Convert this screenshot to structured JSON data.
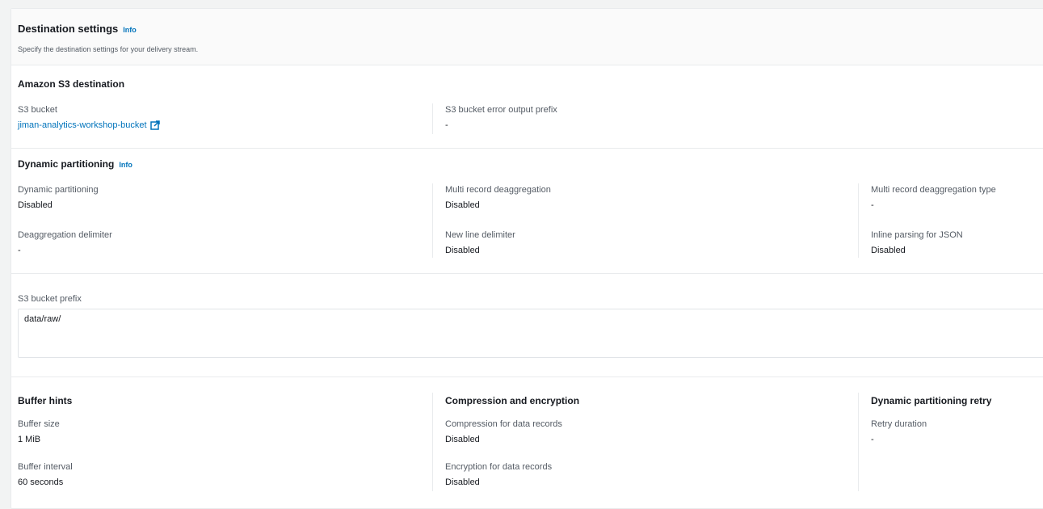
{
  "header": {
    "title": "Destination settings",
    "info": "Info",
    "description": "Specify the destination settings for your delivery stream."
  },
  "s3_destination": {
    "title": "Amazon S3 destination",
    "bucket_label": "S3 bucket",
    "bucket_value": "jiman-analytics-workshop-bucket",
    "error_prefix_label": "S3 bucket error output prefix",
    "error_prefix_value": "-"
  },
  "dynamic_partitioning": {
    "title": "Dynamic partitioning",
    "info": "Info",
    "fields": {
      "dynamic_partitioning": {
        "label": "Dynamic partitioning",
        "value": "Disabled"
      },
      "multi_record_deaggregation": {
        "label": "Multi record deaggregation",
        "value": "Disabled"
      },
      "multi_record_deaggregation_type": {
        "label": "Multi record deaggregation type",
        "value": "-"
      },
      "deaggregation_delimiter": {
        "label": "Deaggregation delimiter",
        "value": "-"
      },
      "new_line_delimiter": {
        "label": "New line delimiter",
        "value": "Disabled"
      },
      "inline_parsing_json": {
        "label": "Inline parsing for JSON",
        "value": "Disabled"
      }
    }
  },
  "s3_prefix": {
    "label": "S3 bucket prefix",
    "value": "data/raw/"
  },
  "buffer_hints": {
    "title": "Buffer hints",
    "size_label": "Buffer size",
    "size_value": "1 MiB",
    "interval_label": "Buffer interval",
    "interval_value": "60 seconds"
  },
  "compression": {
    "title": "Compression and encryption",
    "compression_label": "Compression for data records",
    "compression_value": "Disabled",
    "encryption_label": "Encryption for data records",
    "encryption_value": "Disabled"
  },
  "retry": {
    "title": "Dynamic partitioning retry",
    "duration_label": "Retry duration",
    "duration_value": "-"
  }
}
